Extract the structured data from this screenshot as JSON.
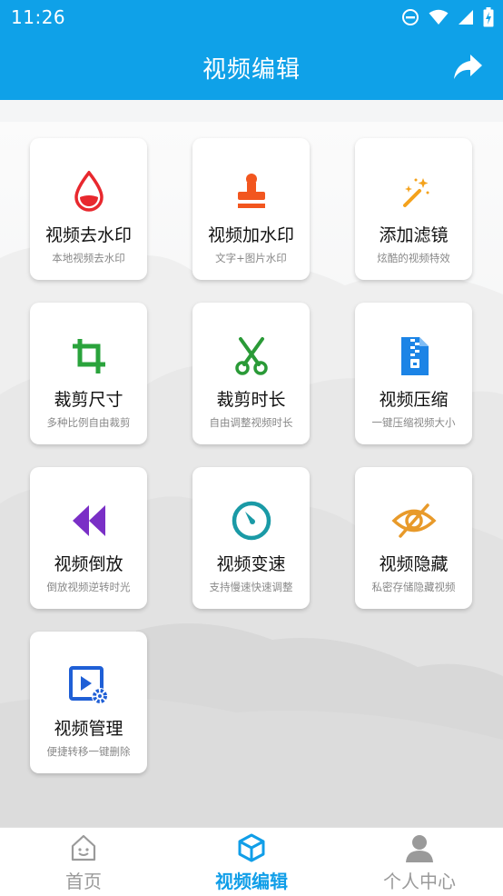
{
  "status_bar": {
    "time": "11:26"
  },
  "app_bar": {
    "title": "视频编辑"
  },
  "features": [
    {
      "title": "视频去水印",
      "subtitle": "本地视频去水印",
      "icon": "water-drop-icon",
      "color": "#e8282e"
    },
    {
      "title": "视频加水印",
      "subtitle": "文字+图片水印",
      "icon": "stamp-icon",
      "color": "#f2561f"
    },
    {
      "title": "添加滤镜",
      "subtitle": "炫酷的视频特效",
      "icon": "magic-wand-icon",
      "color": "#f4a21c"
    },
    {
      "title": "裁剪尺寸",
      "subtitle": "多种比例自由裁剪",
      "icon": "crop-icon",
      "color": "#2aa33c"
    },
    {
      "title": "裁剪时长",
      "subtitle": "自由调整视频时长",
      "icon": "scissors-icon",
      "color": "#2a9a37"
    },
    {
      "title": "视频压缩",
      "subtitle": "一键压缩视频大小",
      "icon": "zip-file-icon",
      "color": "#1c84e6"
    },
    {
      "title": "视频倒放",
      "subtitle": "倒放视频逆转时光",
      "icon": "rewind-icon",
      "color": "#7a2fc6"
    },
    {
      "title": "视频变速",
      "subtitle": "支持慢速快速调整",
      "icon": "speedometer-icon",
      "color": "#1a9aa6"
    },
    {
      "title": "视频隐藏",
      "subtitle": "私密存储隐藏视频",
      "icon": "eye-off-icon",
      "color": "#e89a2a"
    },
    {
      "title": "视频管理",
      "subtitle": "便捷转移一键删除",
      "icon": "video-settings-icon",
      "color": "#1f5fd6"
    }
  ],
  "tabs": [
    {
      "label": "首页",
      "icon": "home-icon",
      "color": "#9a9a9a"
    },
    {
      "label": "视频编辑",
      "icon": "cube-icon",
      "color": "#109ee8",
      "active": true
    },
    {
      "label": "个人中心",
      "icon": "person-icon",
      "color": "#9a9a9a"
    }
  ]
}
